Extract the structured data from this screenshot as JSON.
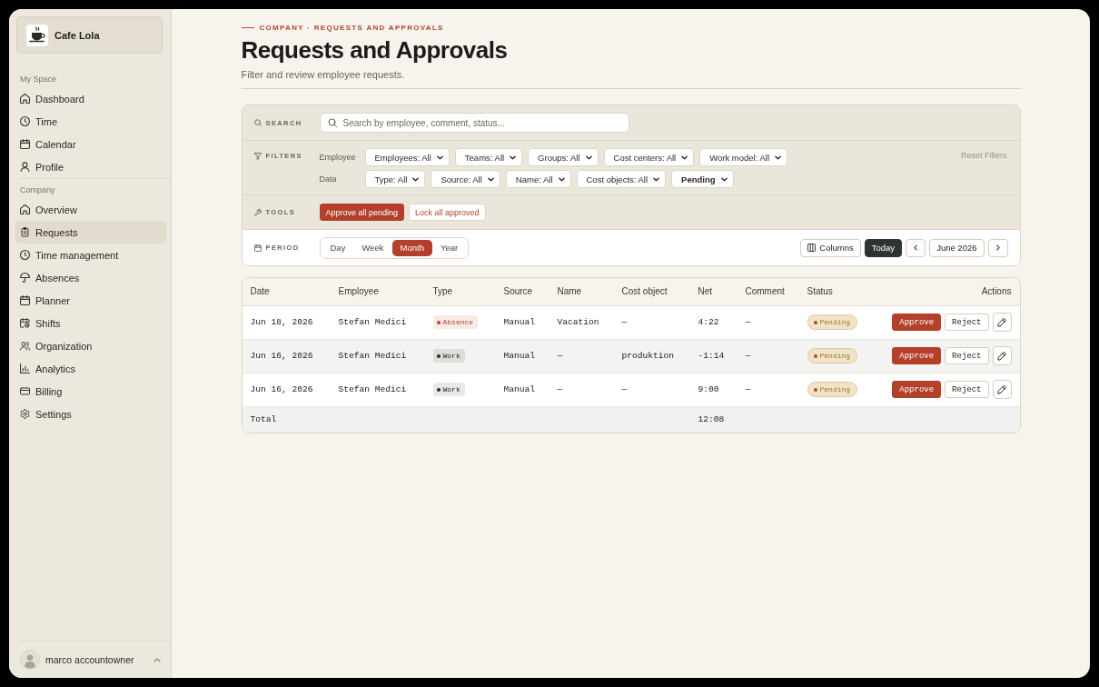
{
  "sidebar": {
    "workspace": {
      "name": "Cafe Lola"
    },
    "sections": [
      {
        "title": "My Space",
        "items": [
          {
            "label": "Dashboard",
            "selected": false
          },
          {
            "label": "Time",
            "selected": false
          },
          {
            "label": "Calendar",
            "selected": false
          },
          {
            "label": "Profile",
            "selected": false
          }
        ]
      },
      {
        "title": "Company",
        "items": [
          {
            "label": "Overview",
            "selected": false
          },
          {
            "label": "Requests",
            "selected": true
          },
          {
            "label": "Time management",
            "selected": false
          },
          {
            "label": "Absences",
            "selected": false
          },
          {
            "label": "Planner",
            "selected": false
          },
          {
            "label": "Shifts",
            "selected": false
          },
          {
            "label": "Organization",
            "selected": false
          },
          {
            "label": "Analytics",
            "selected": false
          },
          {
            "label": "Billing",
            "selected": false
          },
          {
            "label": "Settings",
            "selected": false
          }
        ]
      }
    ],
    "user": {
      "name": "marco accountowner"
    }
  },
  "header": {
    "breadcrumb": "COMPANY · REQUESTS AND APPROVALS",
    "title": "Requests and Approvals",
    "subtitle": "Filter and review employee requests."
  },
  "panel": {
    "search": {
      "label": "SEARCH",
      "placeholder": "Search by employee, comment, status..."
    },
    "filters": {
      "label": "FILTERS",
      "groups": [
        {
          "label": "Employee",
          "selects": [
            {
              "value": "Employees: All",
              "active": false
            },
            {
              "value": "Teams: All",
              "active": false
            },
            {
              "value": "Groups: All",
              "active": false
            },
            {
              "value": "Cost centers: All",
              "active": false
            },
            {
              "value": "Work model: All",
              "active": false
            }
          ]
        },
        {
          "label": "Data",
          "selects": [
            {
              "value": "Type: All",
              "active": false
            },
            {
              "value": "Source: All",
              "active": false
            },
            {
              "value": "Name: All",
              "active": false
            },
            {
              "value": "Cost objects: All",
              "active": false
            },
            {
              "value": "Pending",
              "active": true
            }
          ]
        }
      ],
      "reset": "Reset Filters"
    },
    "tools": {
      "label": "TOOLS",
      "buttons": [
        {
          "label": "Approve all pending",
          "kind": "primary"
        },
        {
          "label": "Lock all approved",
          "kind": "secondary"
        }
      ]
    },
    "period": {
      "label": "PERIOD",
      "options": [
        {
          "label": "Day",
          "selected": false
        },
        {
          "label": "Week",
          "selected": false
        },
        {
          "label": "Month",
          "selected": true
        },
        {
          "label": "Year",
          "selected": false
        }
      ],
      "columns_button": "Columns",
      "today_button": "Today",
      "current": "June 2026"
    }
  },
  "table": {
    "columns": [
      "Date",
      "Employee",
      "Type",
      "Source",
      "Name",
      "Cost object",
      "Net",
      "Comment",
      "Status",
      "Actions"
    ],
    "rows": [
      {
        "date": "Jun 18, 2026",
        "employee": "Stefan Medici",
        "type": {
          "label": "Absence",
          "color": "#b5452e"
        },
        "source": "Manual",
        "name": "Vacation",
        "cost_object": "—",
        "net": "4:22",
        "comment": "—",
        "status": {
          "label": "Pending",
          "kind": "pending"
        },
        "actions": [
          {
            "label": "Approve",
            "kind": "primary"
          },
          {
            "label": "Reject",
            "kind": "secondary"
          },
          {
            "kind": "edit"
          }
        ]
      },
      {
        "date": "Jun 16, 2026",
        "employee": "Stefan Medici",
        "type": {
          "label": "Work",
          "color": "#2b2926"
        },
        "source": "Manual",
        "name": "—",
        "cost_object": "produktion",
        "net": "-1:14",
        "comment": "—",
        "status": {
          "label": "Pending",
          "kind": "pending"
        },
        "actions": [
          {
            "label": "Approve",
            "kind": "primary"
          },
          {
            "label": "Reject",
            "kind": "secondary"
          },
          {
            "kind": "edit"
          }
        ]
      },
      {
        "date": "Jun 16, 2026",
        "employee": "Stefan Medici",
        "type": {
          "label": "Work",
          "color": "#2b2926"
        },
        "source": "Manual",
        "name": "—",
        "cost_object": "—",
        "net": "9:00",
        "comment": "—",
        "status": {
          "label": "Pending",
          "kind": "pending"
        },
        "actions": [
          {
            "label": "Approve",
            "kind": "primary"
          },
          {
            "label": "Reject",
            "kind": "secondary"
          },
          {
            "kind": "edit"
          }
        ]
      }
    ],
    "total": {
      "label": "Total",
      "net": "12:08"
    }
  }
}
